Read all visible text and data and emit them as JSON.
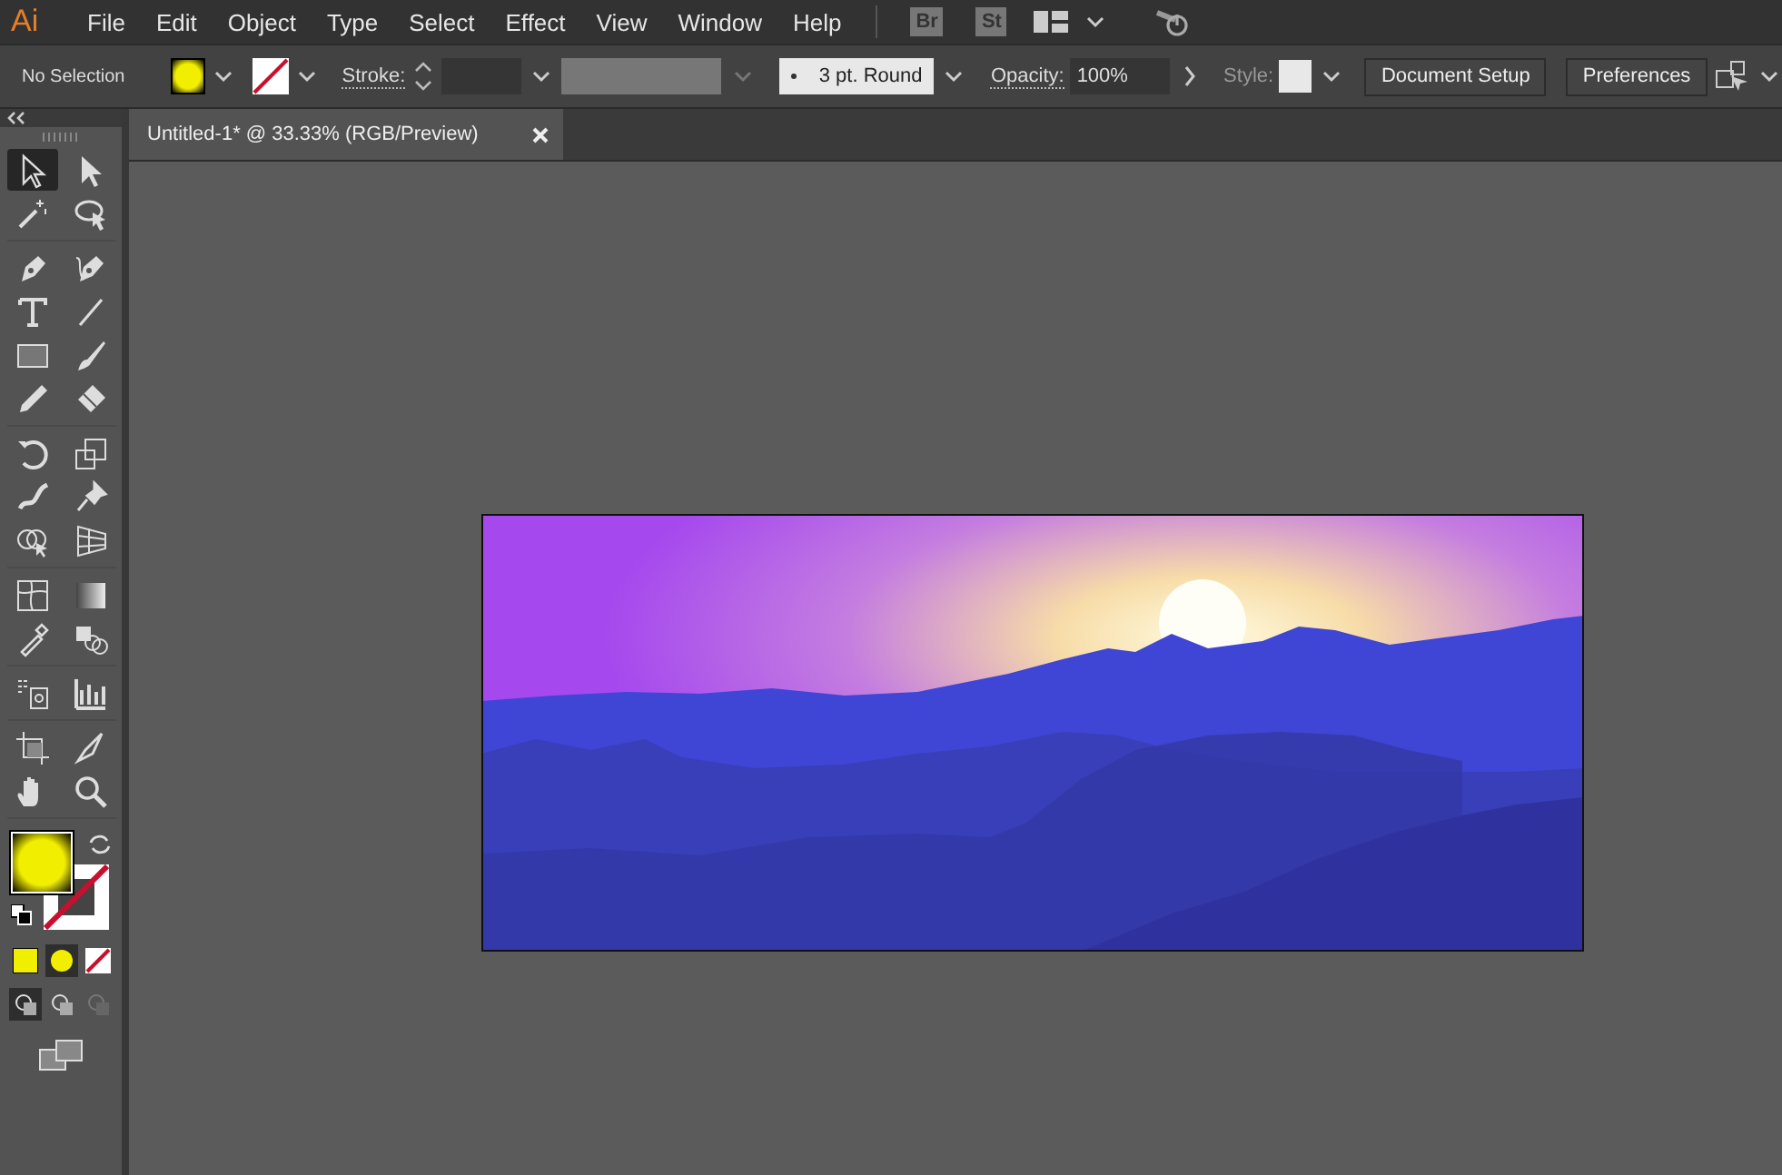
{
  "app_logo": "Ai",
  "menu": [
    "File",
    "Edit",
    "Object",
    "Type",
    "Select",
    "Effect",
    "View",
    "Window",
    "Help"
  ],
  "bridge_badges": [
    "Br",
    "St"
  ],
  "control_bar": {
    "selection_label": "No Selection",
    "stroke_label": "Stroke:",
    "brush": "3 pt. Round",
    "opacity_label": "Opacity:",
    "opacity": "100%",
    "style_label": "Style:",
    "buttons": [
      "Document Setup",
      "Preferences"
    ]
  },
  "document_tab": {
    "title": "Untitled-1* @ 33.33% (RGB/Preview)",
    "selected": true
  },
  "tool_groups": [
    [
      {
        "kind": "selection",
        "selected": true
      },
      {
        "kind": "direct-selection",
        "selected": false
      },
      {
        "kind": "magic-wand",
        "selected": false
      },
      {
        "kind": "lasso",
        "selected": false
      }
    ],
    [
      {
        "kind": "pen",
        "selected": false
      },
      {
        "kind": "curvature-pen",
        "selected": false
      },
      {
        "kind": "type",
        "selected": false
      },
      {
        "kind": "line",
        "selected": false
      },
      {
        "kind": "rectangle",
        "selected": false
      },
      {
        "kind": "paintbrush",
        "selected": false
      },
      {
        "kind": "pencil",
        "selected": false
      },
      {
        "kind": "eraser",
        "selected": false
      }
    ],
    [
      {
        "kind": "rotate",
        "selected": false
      },
      {
        "kind": "scale",
        "selected": false
      },
      {
        "kind": "warp",
        "selected": false
      },
      {
        "kind": "pin",
        "selected": false
      },
      {
        "kind": "shape-builder",
        "selected": false
      },
      {
        "kind": "perspective",
        "selected": false
      }
    ],
    [
      {
        "kind": "mesh",
        "selected": false
      },
      {
        "kind": "gradient",
        "selected": false
      },
      {
        "kind": "eyedropper",
        "selected": false
      },
      {
        "kind": "blend",
        "selected": false
      }
    ],
    [
      {
        "kind": "symbol-sprayer",
        "selected": false
      },
      {
        "kind": "graph",
        "selected": false
      }
    ],
    [
      {
        "kind": "artboard",
        "selected": false
      },
      {
        "kind": "slice",
        "selected": false
      },
      {
        "kind": "hand",
        "selected": false
      },
      {
        "kind": "zoom",
        "selected": false
      }
    ]
  ],
  "fill_stroke": {
    "fill_active": true
  },
  "color_modes": [
    {
      "kind": "color",
      "selected": false
    },
    {
      "kind": "gradient",
      "selected": true
    },
    {
      "kind": "none",
      "selected": false
    }
  ],
  "draw_modes": [
    {
      "kind": "normal",
      "selected": true
    },
    {
      "kind": "behind",
      "selected": false
    },
    {
      "kind": "inside",
      "selected": false
    }
  ]
}
